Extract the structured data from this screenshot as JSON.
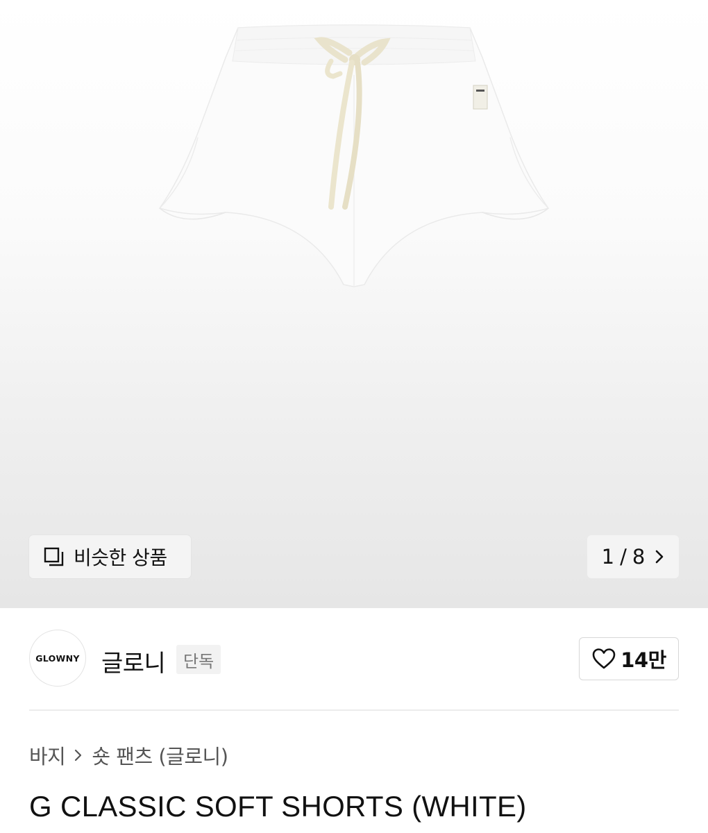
{
  "gallery": {
    "similar_label": "비슷한 상품",
    "current_page": "1",
    "total_pages": "8",
    "separator": "/"
  },
  "brand": {
    "logo_text": "GLOWNY",
    "name": "글로니",
    "badge": "단독",
    "like_count": "14만"
  },
  "breadcrumb": {
    "items": [
      "바지",
      "숏 팬츠 (글로니)"
    ]
  },
  "product": {
    "title": "G CLASSIC SOFT SHORTS (WHITE)"
  },
  "icons": {
    "similar": "similar-items-icon",
    "next": "chevron-right-icon",
    "like": "heart-outline-icon",
    "breadcrumb_separator": "chevron-right-icon"
  },
  "colors": {
    "text": "#111111",
    "muted": "#777777",
    "button_bg": "#f4f4f4",
    "border": "#d7d7d7"
  }
}
